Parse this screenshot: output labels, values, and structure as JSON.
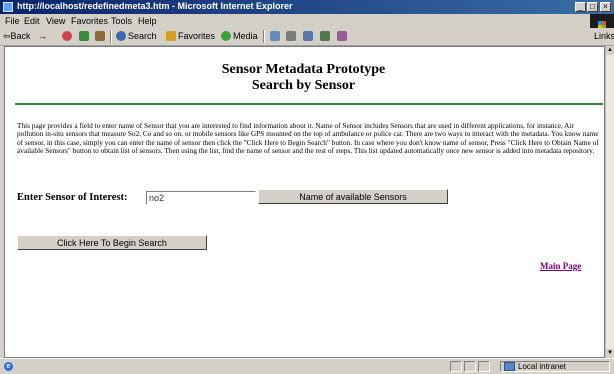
{
  "window": {
    "title": "http://localhost/redefinedmeta3.htm - Microsoft Internet Explorer",
    "controls": {
      "minimize": "_",
      "maximize": "□",
      "close": "×"
    }
  },
  "menu": [
    "File",
    "Edit",
    "View",
    "Favorites",
    "Tools",
    "Help"
  ],
  "toolbar": {
    "back": "⇦Back",
    "forward_arrow": "→",
    "search": "Search",
    "favorites": "Favorites",
    "media": "Media",
    "links": "Links"
  },
  "page": {
    "heading_line1": "Sensor Metadata Prototype",
    "heading_line2": "Search by Sensor",
    "description": "This page provides a field to enter name of Sensor that you are interested to find information about it. Name of Sensor includes Sensors that are used in different applications, for instance, Air pollution in-situ sensors that measure So2, Co and so on. or mobile sensors like GPS mounted on the top of ambulance or police car. There are two ways to interact with the metadata. You know name of sensor, in this case, simply you can enter the name of sensor then click the \"Click Here to Begin Search\" button. In case where you don't know name of sensor, Press \"Click Here to Obtain Name of available Sensors\" button to obtain list of sensors. Then using the list, find the name of sensor and the rest of steps. This list updated automatically once new sensor is added into metadata repository.",
    "sensor_label": "Enter Sensor of Interest:",
    "sensor_value": "no2",
    "sensors_button": "Name of available Sensors",
    "search_button": "Click Here To Begin Search",
    "main_page_link": "Main Page"
  },
  "status": {
    "ie_icon_letter": "e",
    "zone": "Local intranet"
  },
  "colors": {
    "title_bar": "#0a246a",
    "rule": "#2e8a2e",
    "visited_link": "#800080"
  }
}
